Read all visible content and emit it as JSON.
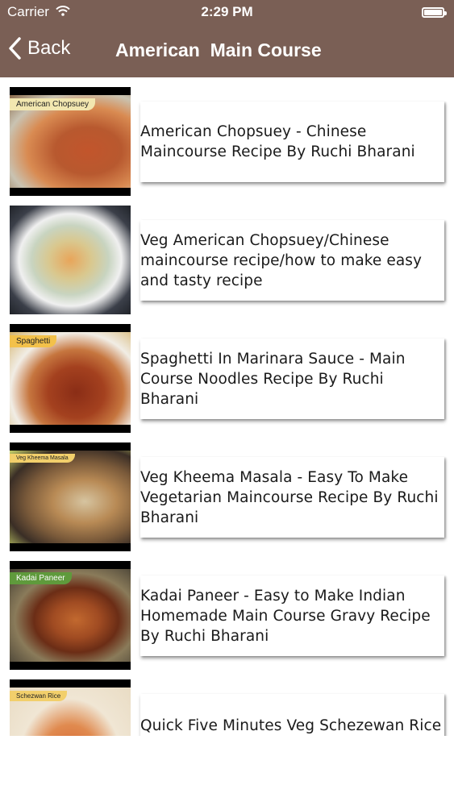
{
  "status_bar": {
    "carrier": "Carrier",
    "time": "2:29 PM",
    "battery_icon": "battery-full-icon",
    "wifi_icon": "wifi-icon"
  },
  "nav": {
    "back_label": "Back",
    "title": "American  Main Course",
    "background_color": "#7a5f55"
  },
  "recipes": [
    {
      "thumb_label": "American Chopsuey",
      "title": "American Chopsuey - Chinese Maincourse Recipe By Ruchi Bharani"
    },
    {
      "thumb_label": "",
      "title": "Veg American Chopsuey/Chinese maincourse recipe/how to make easy and tasty recipe"
    },
    {
      "thumb_label": "Spaghetti",
      "title": "Spaghetti In Marinara Sauce - Main Course Noodles Recipe By Ruchi Bharani"
    },
    {
      "thumb_label": "Veg Kheema Masala",
      "title": "Veg Kheema Masala - Easy To Make Vegetarian Maincourse Recipe By Ruchi Bharani"
    },
    {
      "thumb_label": "Kadai Paneer",
      "title": "Kadai Paneer - Easy to Make Indian Homemade Main Course Gravy Recipe By Ruchi Bharani"
    },
    {
      "thumb_label": "Schezwan Rice",
      "title": "Quick Five Minutes Veg Schezewan Rice Recipe - Chinese Main Course"
    }
  ]
}
